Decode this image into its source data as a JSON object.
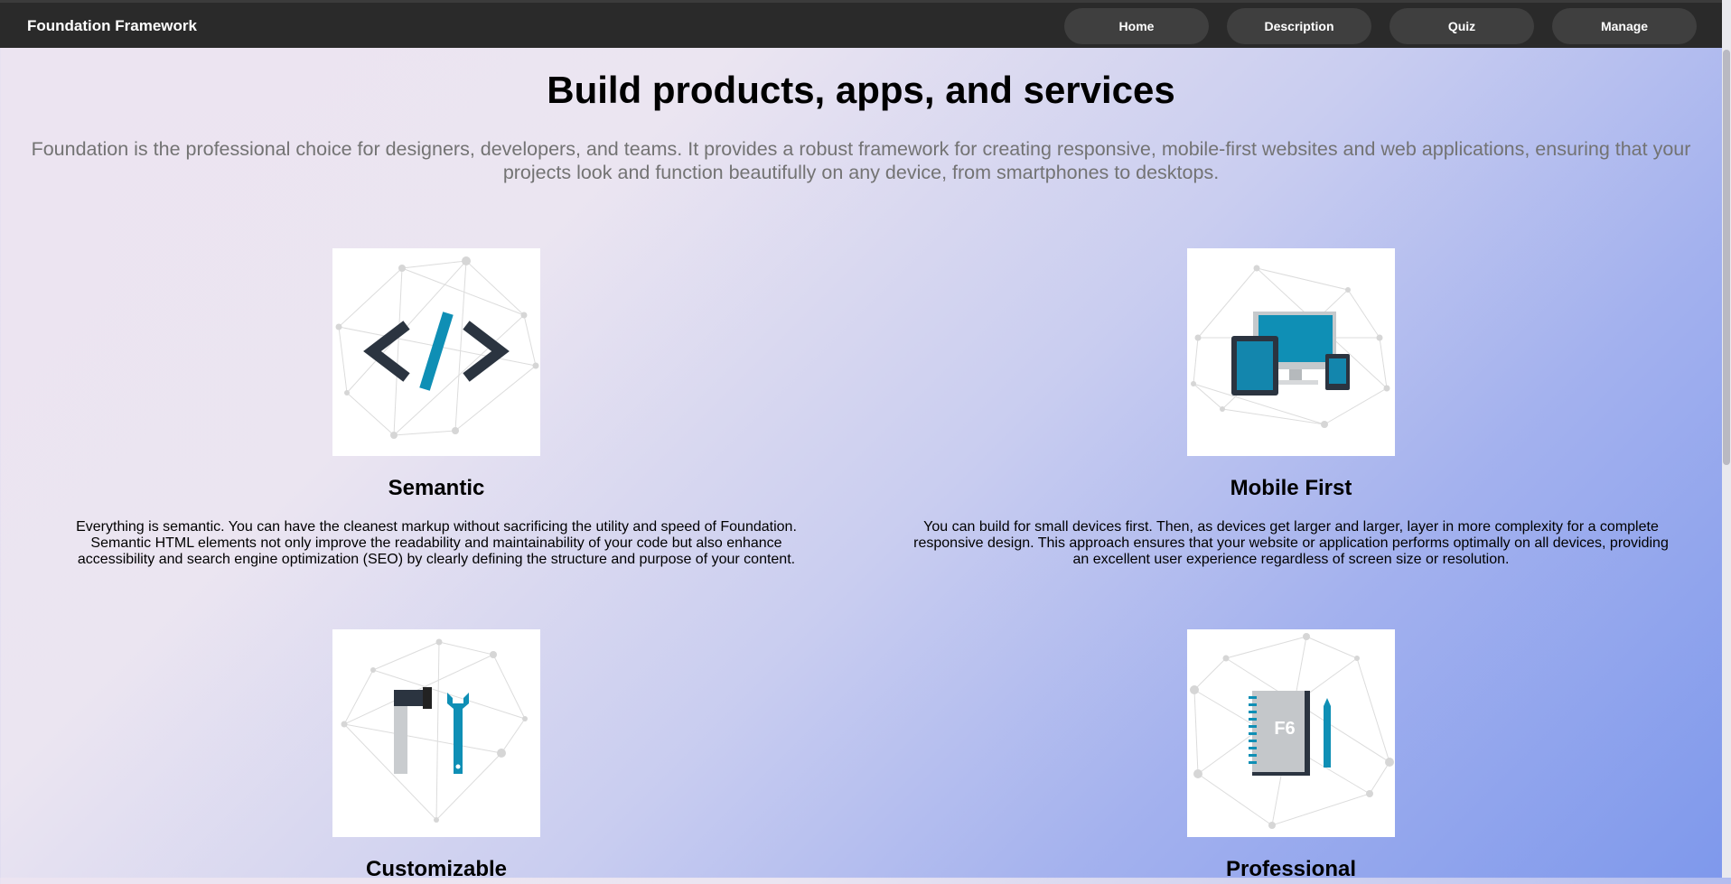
{
  "brand": "Foundation Framework",
  "nav": [
    {
      "label": "Home"
    },
    {
      "label": "Description"
    },
    {
      "label": "Quiz"
    },
    {
      "label": "Manage"
    }
  ],
  "hero": {
    "title": "Build products, apps, and services",
    "description": "Foundation is the professional choice for designers, developers, and teams. It provides a robust framework for creating responsive, mobile-first websites and web applications, ensuring that your projects look and function beautifully on any device, from smartphones to desktops."
  },
  "features": [
    {
      "title": "Semantic",
      "icon": "code-icon",
      "text": "Everything is semantic. You can have the cleanest markup without sacrificing the utility and speed of Foundation. Semantic HTML elements not only improve the readability and maintainability of your code but also enhance accessibility and search engine optimization (SEO) by clearly defining the structure and purpose of your content."
    },
    {
      "title": "Mobile First",
      "icon": "devices-icon",
      "text": "You can build for small devices first. Then, as devices get larger and larger, layer in more complexity for a complete responsive design. This approach ensures that your website or application performs optimally on all devices, providing an excellent user experience regardless of screen size or resolution."
    },
    {
      "title": "Customizable",
      "icon": "tools-icon",
      "text": ""
    },
    {
      "title": "Professional",
      "icon": "notebook-icon",
      "notebook_label": "F6",
      "text": ""
    }
  ],
  "colors": {
    "accent": "#0f8fb5",
    "dark": "#2b3440",
    "navbar": "#2a2a2a"
  }
}
